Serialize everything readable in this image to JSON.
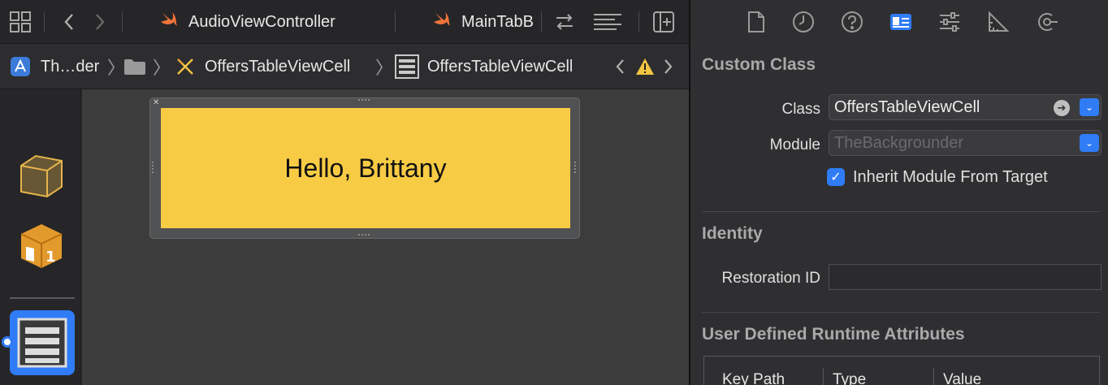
{
  "tabbar": {
    "tabs": [
      {
        "label": "AudioViewController"
      },
      {
        "label": "MainTabB"
      }
    ]
  },
  "jumpbar": {
    "crumb1": "Th…der",
    "crumb3": "OffersTableViewCell",
    "crumb4": "OffersTableViewCell"
  },
  "canvas": {
    "cell_text": "Hello, Brittany"
  },
  "inspector": {
    "custom_class": {
      "title": "Custom Class",
      "class_label": "Class",
      "class_value": "OffersTableViewCell",
      "module_label": "Module",
      "module_placeholder": "TheBackgrounder",
      "inherit_label": "Inherit Module From Target"
    },
    "identity": {
      "title": "Identity",
      "restoration_label": "Restoration ID"
    },
    "runtime": {
      "title": "User Defined Runtime Attributes",
      "columns": [
        "Key Path",
        "Type",
        "Value"
      ]
    }
  },
  "colors": {
    "accent": "#2f7cf6",
    "cell_background": "#f8cb45",
    "swift": "#f0743a"
  }
}
